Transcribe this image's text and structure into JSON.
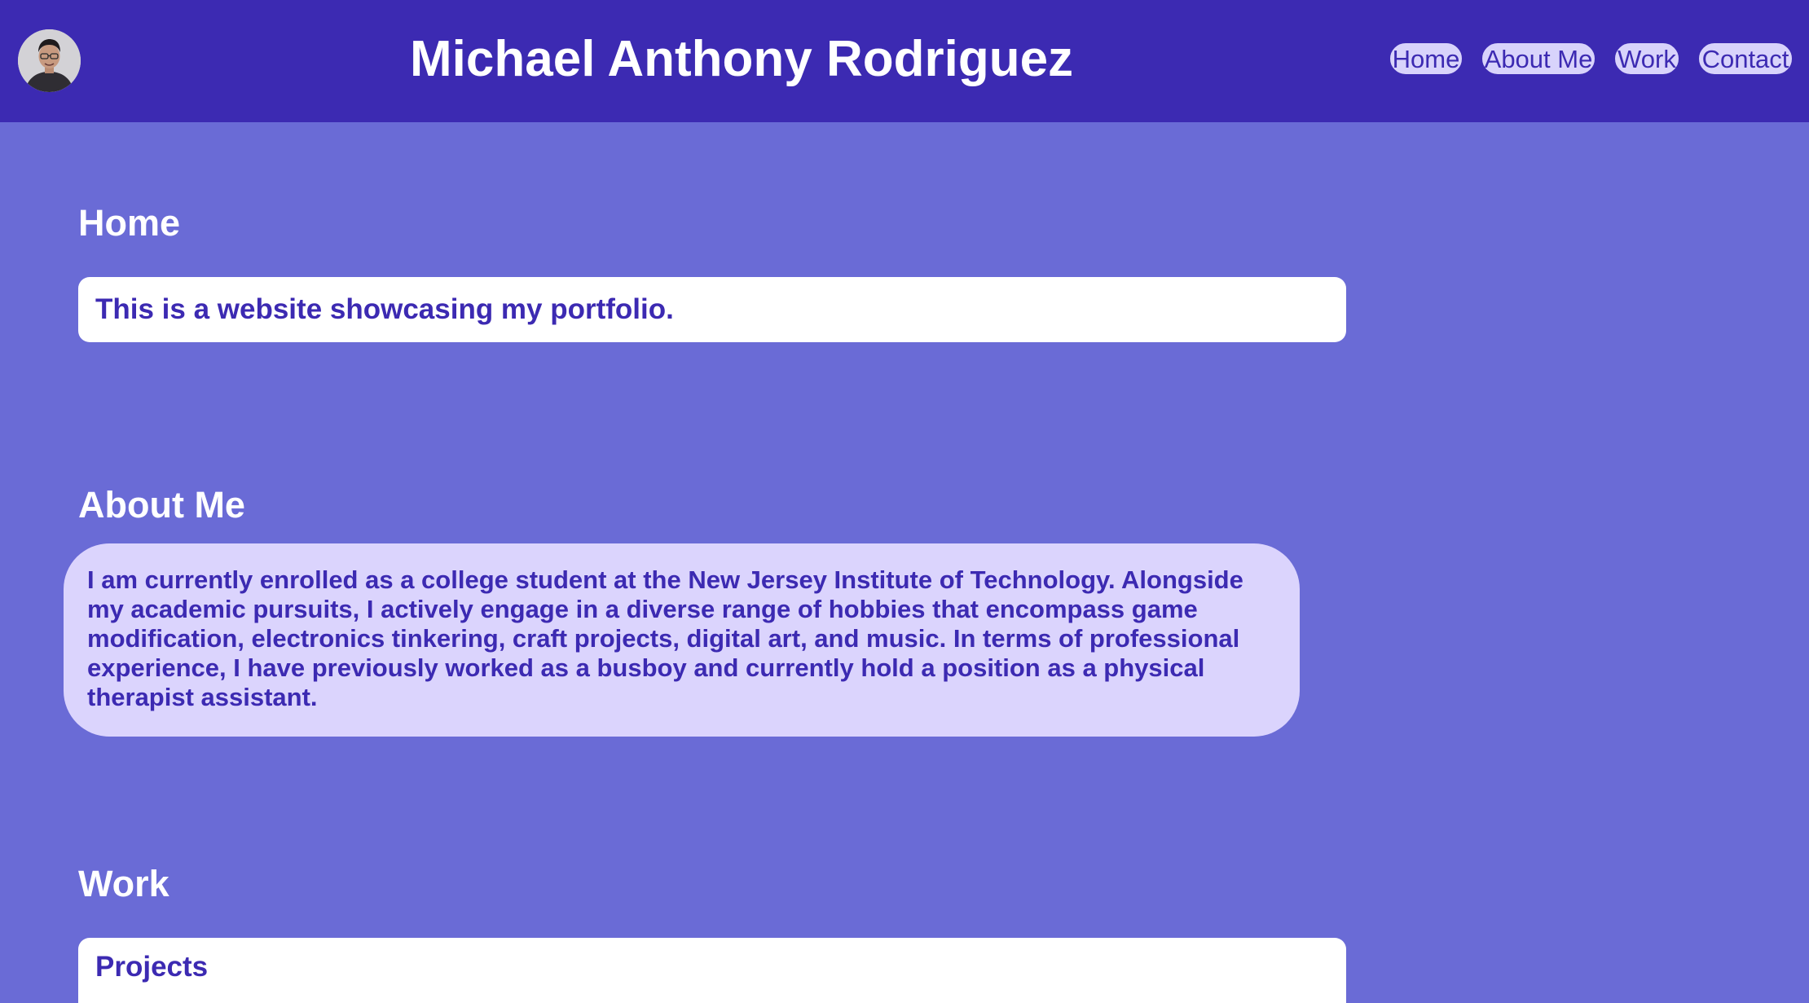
{
  "header": {
    "title": "Michael Anthony Rodriguez",
    "avatar_icon": "profile-photo",
    "nav": {
      "home": "Home",
      "about": "About Me",
      "work": "Work",
      "contact": "Contact"
    }
  },
  "sections": {
    "home": {
      "title": "Home",
      "text": "This is a website showcasing my portfolio."
    },
    "about": {
      "title": "About Me",
      "text": "I am currently enrolled as a college student at the New Jersey Institute of Technology. Alongside my academic pursuits, I actively engage in a diverse range of hobbies that encompass game modification, electronics tinkering, craft projects, digital art, and music. In terms of professional experience, I have previously worked as a busboy and currently hold a position as a physical therapist assistant."
    },
    "work": {
      "title": "Work",
      "subtitle": "Projects"
    }
  },
  "colors": {
    "header_bg": "#3c2ab2",
    "page_bg": "#6a6bd6",
    "accent_text": "#3c2ab2",
    "about_card_bg": "#dbd4fd",
    "nav_bg": "#d8d3fb"
  }
}
